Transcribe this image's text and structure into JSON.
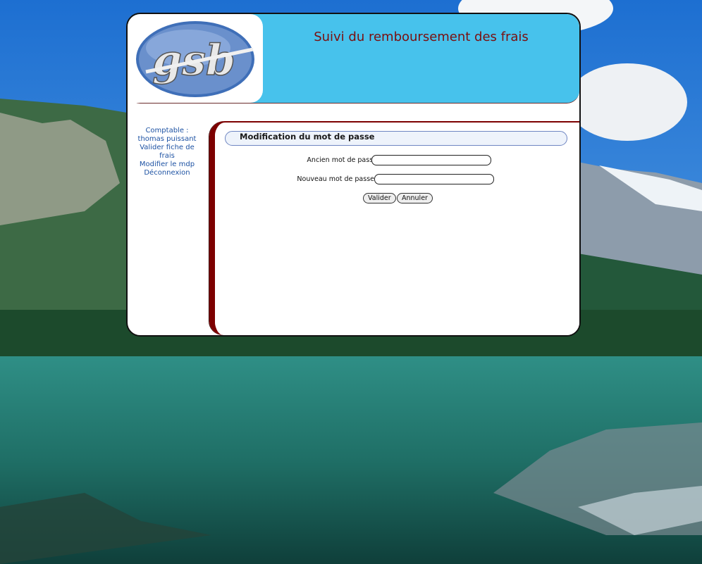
{
  "header": {
    "logo_text": "gsb",
    "title": "Suivi du remboursement des frais"
  },
  "menu": {
    "role_label": "Comptable :",
    "user_name": "thomas puissant",
    "items": [
      {
        "label": "Valider fiche de frais"
      },
      {
        "label": "Modifier le mdp"
      },
      {
        "label": "Déconnexion"
      }
    ]
  },
  "form": {
    "title": "Modification du mot de passe",
    "old_password_label": "Ancien mot de passe",
    "old_password_value": "",
    "new_password_label": "Nouveau mot de passe",
    "new_password_value": "",
    "submit_label": "Valider",
    "cancel_label": "Annuler"
  },
  "colors": {
    "header_bg": "#47c2ec",
    "title_color": "#7a0f0f",
    "menu_link": "#1d52a3",
    "content_border": "#7d0000"
  }
}
